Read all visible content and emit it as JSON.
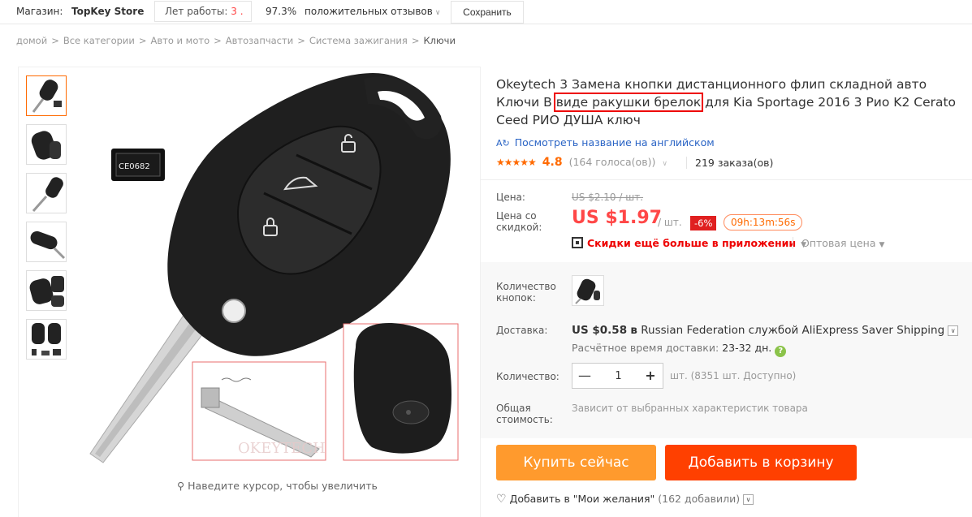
{
  "store": {
    "label": "Магазин:",
    "name": "TopKey Store",
    "years_label": "Лет работы:",
    "years_value": "3 .",
    "positive_pct": "97.3%",
    "positive_label": "положительных отзывов",
    "save_label": "Сохранить"
  },
  "breadcrumb": [
    "домой",
    "Все категории",
    "Авто и мото",
    "Автозапчасти",
    "Система зажигания",
    "Ключи"
  ],
  "gallery": {
    "zoom_hint": "Наведите курсор, чтобы увеличить",
    "chip_text": "CE0682",
    "watermark": "OKEYTECH"
  },
  "product": {
    "title_part1": "Okeytech 3 Замена кнопки дистанционного флип складной авто Ключи В ",
    "title_highlight": "виде ракушки брелок",
    "title_part2": " для Kia Sportage 2016 3 Рио K2 Cerato Ceed РИО ДУША ключ",
    "translate_label": "Посмотреть название на английском",
    "stars": "★★★★★",
    "rating": "4.8",
    "votes": "(164 голоса(ов))",
    "orders": "219 заказа(ов)"
  },
  "price": {
    "label": "Цена:",
    "old": "US $2.10 / шт.",
    "discount_label_1": "Цена со",
    "discount_label_2": "скидкой:",
    "current": "US $1.97",
    "per": "/ шт.",
    "badge": "-6%",
    "timer": "09h:13m:56s",
    "app_deal": "Скидки ещё больше в приложении",
    "wholesale": "Оптовая цена"
  },
  "options": {
    "buttons_label_1": "Количество",
    "buttons_label_2": "кнопок:",
    "delivery_label": "Доставка:",
    "ship_price": "US $0.58",
    "ship_text_1": "в",
    "ship_text_2": "Russian Federation службой AliExpress Saver Shipping",
    "eta_label": "Расчётное время доставки:",
    "eta_days": "23-32 дн.",
    "qty_label": "Количество:",
    "qty_value": "1",
    "stock": "шт. (8351 шт. Доступно)",
    "total_label_1": "Общая",
    "total_label_2": "стоимость:",
    "total_value": "Зависит от выбранных характеристик товара"
  },
  "actions": {
    "buy_now": "Купить сейчас",
    "add_to_cart": "Добавить в корзину",
    "wishlist": "Добавить в \"Мои желания\"",
    "wishlist_count": "(162 добавили)"
  },
  "colors": {
    "accent": "#ff6a00",
    "price": "#ff4747",
    "buy_now": "#ff9a2d",
    "add_to_cart": "#ff4000",
    "link": "#2a64c5"
  }
}
